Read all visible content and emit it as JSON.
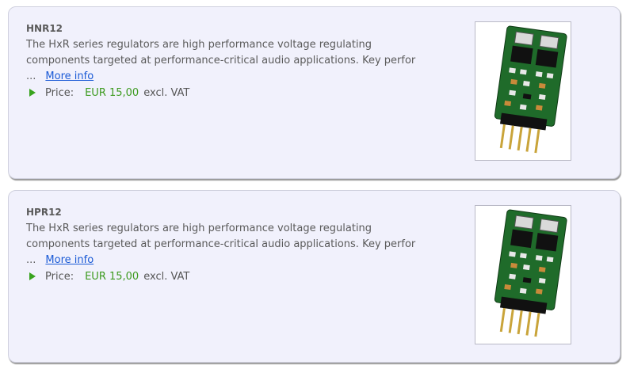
{
  "products": [
    {
      "name": "HNR12",
      "description": "The HxR series regulators are high performance voltage regulating components targeted at performance-critical audio applications. Key perfor ...",
      "more_label": "More info",
      "price_label": "Price:",
      "price_value": "EUR 15,00",
      "price_suffix": "excl. VAT",
      "image_icon": "circuit-board-icon"
    },
    {
      "name": "HPR12",
      "description": "The HxR series regulators are high performance voltage regulating components targeted at performance-critical audio applications. Key perfor ...",
      "more_label": "More info",
      "price_label": "Price:",
      "price_value": "EUR 15,00",
      "price_suffix": "excl. VAT",
      "image_icon": "circuit-board-icon"
    }
  ],
  "colors": {
    "card_bg": "#f1f1fc",
    "price_green": "#3c9a1e",
    "link_blue": "#1a5ad6",
    "pcb_green": "#1f6b2a"
  }
}
